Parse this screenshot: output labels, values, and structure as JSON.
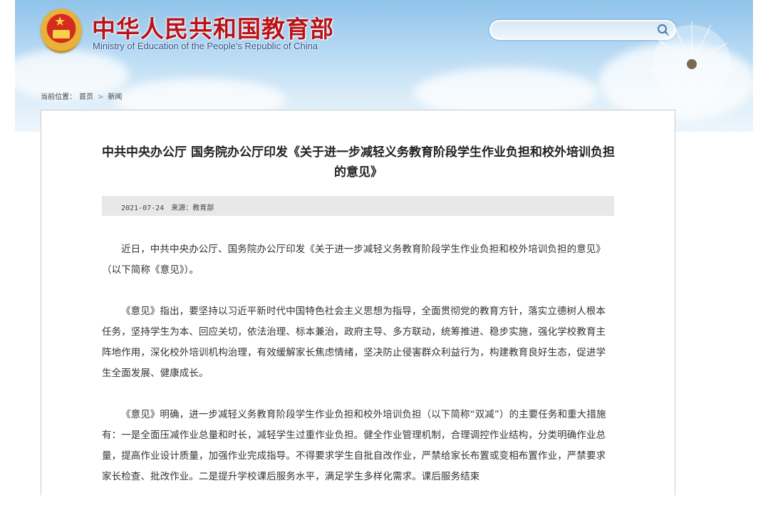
{
  "header": {
    "title": "中华人民共和国教育部",
    "subtitle": "Ministry of Education of the People's Republic of China",
    "search_placeholder": ""
  },
  "breadcrumb": {
    "label": "当前位置：",
    "home": "首页",
    "separator": ">",
    "current": "新闻"
  },
  "article": {
    "title": "中共中央办公厅 国务院办公厅印发《关于进一步减轻义务教育阶段学生作业负担和校外培训负担的意见》",
    "date": "2021-07-24",
    "source": "来源：教育部",
    "paragraphs": [
      "近日，中共中央办公厅、国务院办公厅印发《关于进一步减轻义务教育阶段学生作业负担和校外培训负担的意见》（以下简称《意见》）。",
      "《意见》指出，要坚持以习近平新时代中国特色社会主义思想为指导，全面贯彻党的教育方针，落实立德树人根本任务，坚持学生为本、回应关切，依法治理、标本兼治，政府主导、多方联动，统筹推进、稳步实施，强化学校教育主阵地作用，深化校外培训机构治理，有效缓解家长焦虑情绪，坚决防止侵害群众利益行为，构建教育良好生态，促进学生全面发展、健康成长。",
      "《意见》明确，进一步减轻义务教育阶段学生作业负担和校外培训负担（以下简称“双减”）的主要任务和重大措施有：一是全面压减作业总量和时长，减轻学生过重作业负担。健全作业管理机制，合理调控作业结构，分类明确作业总量，提高作业设计质量，加强作业完成指导。不得要求学生自批自改作业，严禁给家长布置或变相布置作业，严禁要求家长检查、批改作业。二是提升学校课后服务水平，满足学生多样化需求。课后服务结束"
    ]
  },
  "colors": {
    "title_red": "#b9131a",
    "subtitle_blue": "#2a4f86",
    "banner_sky": "#8fc3ea",
    "meta_bar": "#e8e8e8"
  }
}
